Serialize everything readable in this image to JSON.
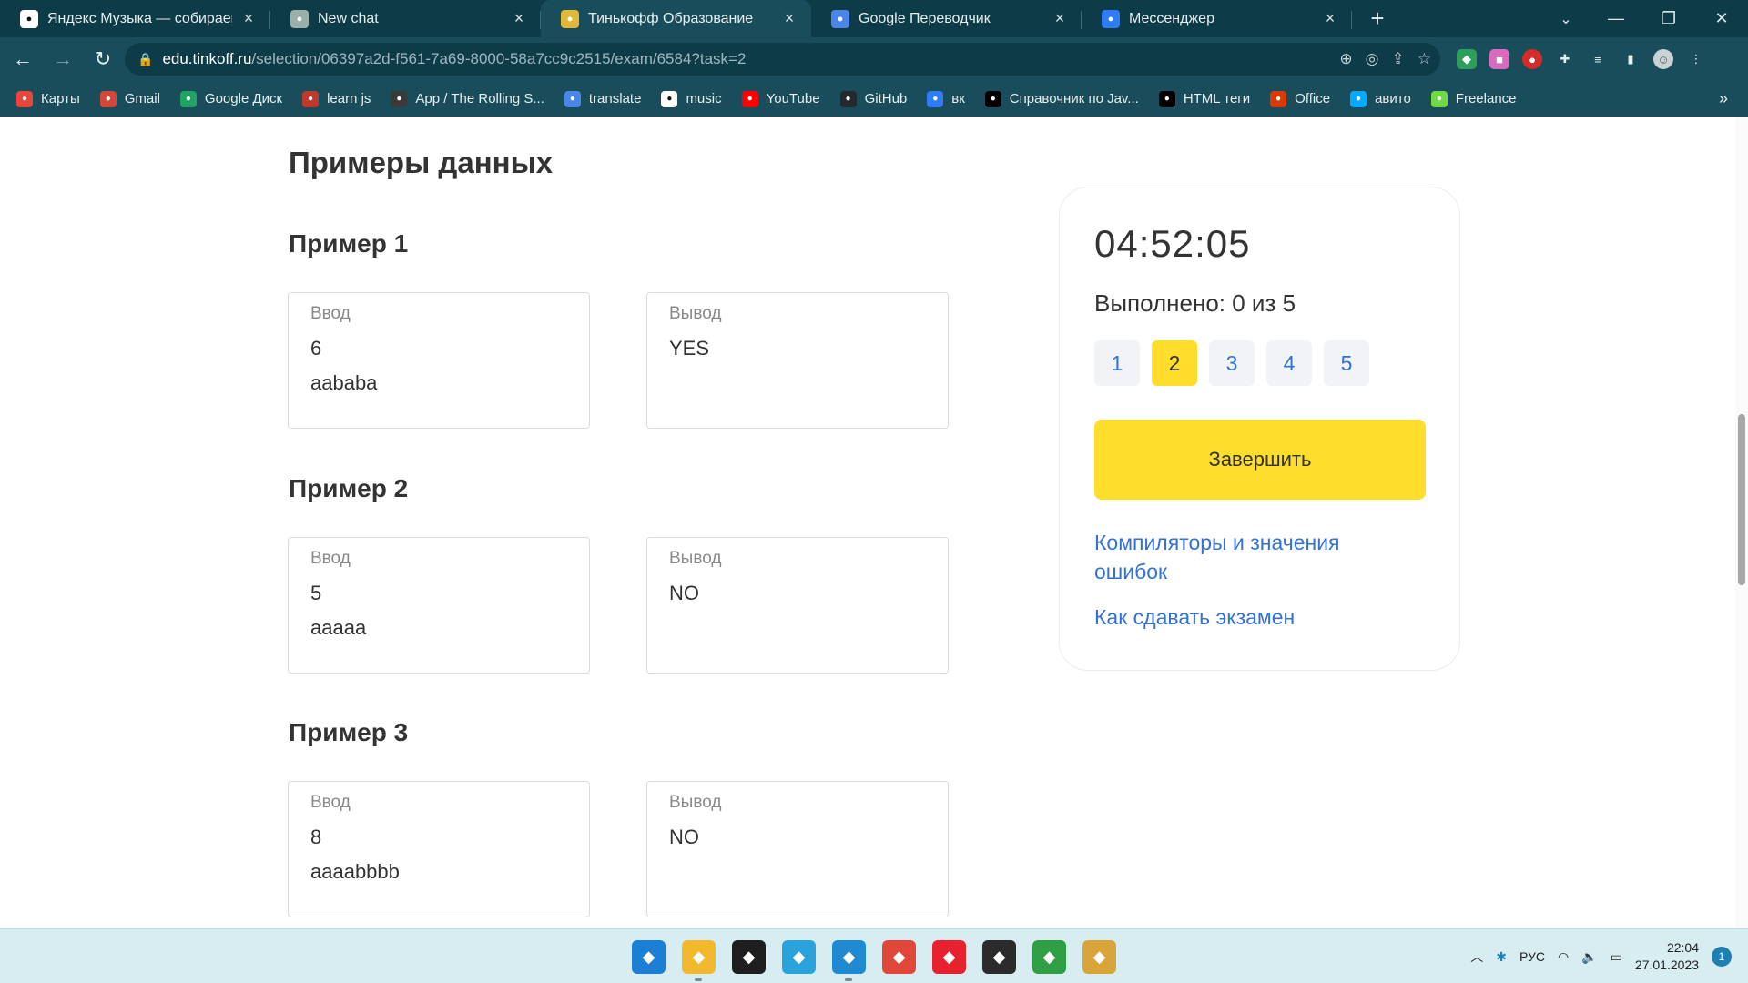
{
  "browser": {
    "tabs": [
      {
        "title": "Яндекс Музыка — собираем му",
        "favicon": "yandex-music-icon",
        "color": "#ffffff",
        "active": false
      },
      {
        "title": "New chat",
        "favicon": "chatgpt-icon",
        "color": "#9ab0a9",
        "active": false
      },
      {
        "title": "Тинькофф Образование",
        "favicon": "tinkoff-icon",
        "color": "#e0b93a",
        "active": true
      },
      {
        "title": "Google Переводчик",
        "favicon": "google-translate-icon",
        "color": "#4a86e8",
        "active": false
      },
      {
        "title": "Мессенджер",
        "favicon": "messenger-icon",
        "color": "#2f7cf6",
        "active": false
      }
    ],
    "url_host": "edu.tinkoff.ru",
    "url_path": "/selection/06397a2d-f561-7a69-8000-58a7cc9c2515/exam/6584?task=2",
    "bookmarks": [
      {
        "label": "Карты",
        "icon": "maps-pin-icon",
        "color": "#e8453c"
      },
      {
        "label": "Gmail",
        "icon": "gmail-icon",
        "color": "#d44638"
      },
      {
        "label": "Google Диск",
        "icon": "google-drive-icon",
        "color": "#1fa463"
      },
      {
        "label": "learn js",
        "icon": "learn-js-icon",
        "color": "#c0392b"
      },
      {
        "label": "App / The Rolling S...",
        "icon": "rolling-scopes-icon",
        "color": "#3a3a3a"
      },
      {
        "label": "translate",
        "icon": "google-translate-icon",
        "color": "#4a86e8"
      },
      {
        "label": "music",
        "icon": "yandex-music-icon",
        "color": "#ffffff"
      },
      {
        "label": "YouTube",
        "icon": "youtube-icon",
        "color": "#ff0000"
      },
      {
        "label": "GitHub",
        "icon": "github-icon",
        "color": "#24292e"
      },
      {
        "label": "вк",
        "icon": "messenger-icon",
        "color": "#2f7cf6"
      },
      {
        "label": "Справочник по Jav...",
        "icon": "mdn-icon",
        "color": "#000000"
      },
      {
        "label": "HTML теги",
        "icon": "mdn-icon",
        "color": "#000000"
      },
      {
        "label": "Office",
        "icon": "office-icon",
        "color": "#d83b01"
      },
      {
        "label": "авито",
        "icon": "avito-icon",
        "color": "#00aaff"
      },
      {
        "label": "Freelance",
        "icon": "freelance-icon",
        "color": "#6fda44"
      }
    ]
  },
  "page": {
    "section_title": "Примеры данных",
    "input_label": "Ввод",
    "output_label": "Вывод",
    "examples": [
      {
        "title": "Пример 1",
        "input": [
          "6",
          "aababa"
        ],
        "output": [
          "YES"
        ]
      },
      {
        "title": "Пример 2",
        "input": [
          "5",
          "aaaaa"
        ],
        "output": [
          "NO"
        ]
      },
      {
        "title": "Пример 3",
        "input": [
          "8",
          "aaaabbbb"
        ],
        "output": [
          "NO"
        ]
      }
    ]
  },
  "sidebar": {
    "timer": "04:52:05",
    "progress": "Выполнено: 0 из 5",
    "tasks": [
      "1",
      "2",
      "3",
      "4",
      "5"
    ],
    "current_task": 2,
    "finish_label": "Завершить",
    "link_compilers": "Компиляторы и значения ошибок",
    "link_howto": "Как сдавать экзамен"
  },
  "taskbar": {
    "apps": [
      {
        "name": "windows-start-icon",
        "color": "#1b7fd6"
      },
      {
        "name": "file-explorer-icon",
        "color": "#f2b92c",
        "running": true
      },
      {
        "name": "figma-icon",
        "color": "#1e1e1e"
      },
      {
        "name": "telegram-icon",
        "color": "#2aa3dd"
      },
      {
        "name": "vscode-icon",
        "color": "#1f8ad2",
        "running": true
      },
      {
        "name": "chrome-icon",
        "color": "#e0463a",
        "focused": true
      },
      {
        "name": "opera-icon",
        "color": "#e8212e"
      },
      {
        "name": "terminal-icon",
        "color": "#2b2b2b"
      },
      {
        "name": "notepad-icon",
        "color": "#2f9e44"
      },
      {
        "name": "chrome-dev-icon",
        "color": "#d9a43a"
      }
    ],
    "language": "РУС",
    "time": "22:04",
    "date": "27.01.2023",
    "notifications": "1"
  }
}
